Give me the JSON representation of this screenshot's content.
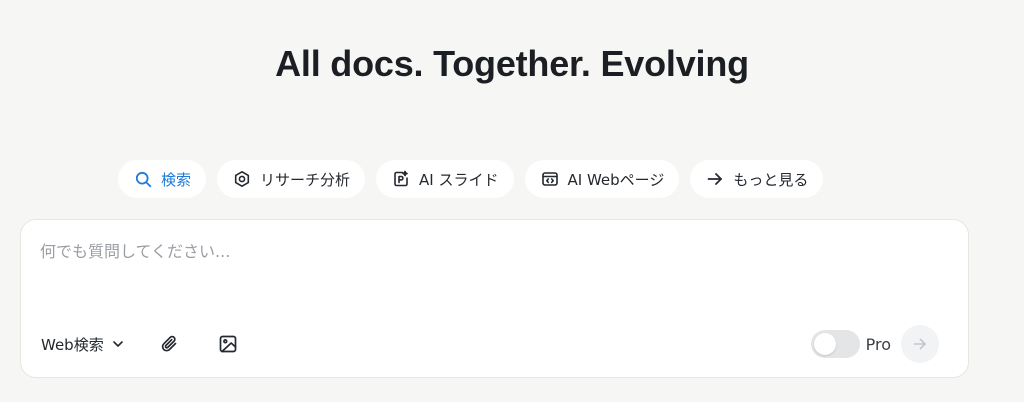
{
  "headline": "All docs. Together. Evolving",
  "chips": [
    {
      "label": "検索",
      "icon": "search-icon",
      "active": true
    },
    {
      "label": "リサーチ分析",
      "icon": "research-icon",
      "active": false
    },
    {
      "label": "AI スライド",
      "icon": "slides-icon",
      "active": false
    },
    {
      "label": "AI Webページ",
      "icon": "webpage-icon",
      "active": false
    },
    {
      "label": "もっと見る",
      "icon": "arrow-right-icon",
      "active": false
    }
  ],
  "composer": {
    "placeholder": "何でも質問してください...",
    "value": "",
    "search_mode": "Web検索",
    "pro_label": "Pro",
    "pro_enabled": false
  },
  "colors": {
    "background": "#f6f6f4",
    "active_chip": "#1e7bd8",
    "placeholder": "#9a9ea4"
  }
}
